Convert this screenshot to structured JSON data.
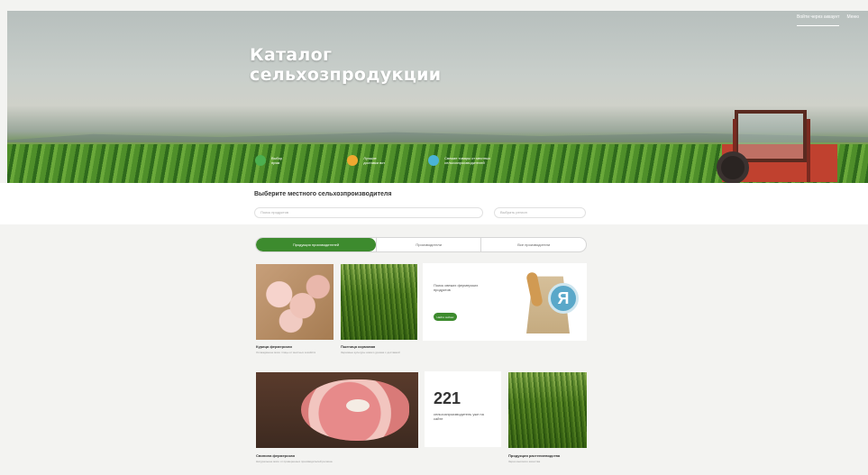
{
  "hero": {
    "title_line1": "Каталог",
    "title_line2": "сельхозпродукции",
    "nav": [
      "Войти через аккаунт",
      "Меню"
    ]
  },
  "features": [
    {
      "text": "Выбор\nпрям",
      "color": "#4caf50"
    },
    {
      "text": "Лучшие\nдоставки вот",
      "color": "#f0a830"
    },
    {
      "text": "Свежие товары от местных\nсельхозпроизводителей",
      "color": "#4ab3d6"
    }
  ],
  "search": {
    "title": "Выберите местного сельхозпроизводителя",
    "placeholder": "Поиск продуктов",
    "region_placeholder": "Выбрать регион"
  },
  "tabs": [
    "Продукция производителей",
    "Производители",
    "Все производители"
  ],
  "cards": [
    {
      "title": "Курица фермерская",
      "text": "Охлаждённое мясо птицы от местных хозяйств"
    },
    {
      "title": "Пшеница кормовая",
      "text": "Зерновые культуры нового урожая с доставкой"
    },
    {
      "title": "Свинина фермерская",
      "text": "Натуральное мясо от проверенных производителей региона"
    },
    {
      "title": "Продукция растениеводства",
      "text": "Зерно высокого качества"
    }
  ],
  "promo": {
    "text": "Поиск свежих фермерских продуктов",
    "button": "Найти сейчас",
    "badge": "Я"
  },
  "stat": {
    "number": "221",
    "text": "сельхозпроизводитель уже на сайте"
  }
}
